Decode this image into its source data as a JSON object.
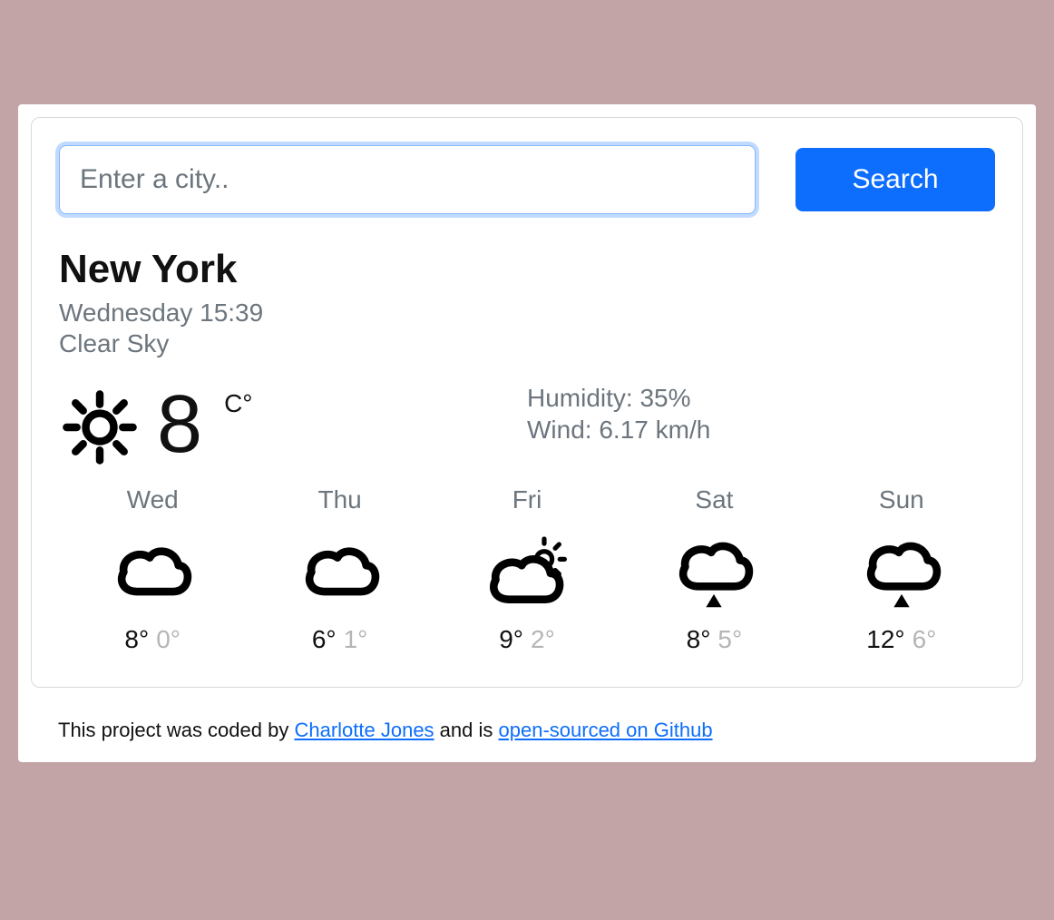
{
  "search": {
    "placeholder": "Enter a city..",
    "button_label": "Search",
    "value": ""
  },
  "current": {
    "city": "New York",
    "day_time": "Wednesday 15:39",
    "condition": "Clear Sky",
    "temp": "8",
    "unit": "C°",
    "icon": "sun",
    "humidity_label": "Humidity: 35%",
    "wind_label": "Wind: 6.17 km/h"
  },
  "forecast": [
    {
      "day": "Wed",
      "icon": "cloud",
      "hi": "8°",
      "lo": "0°"
    },
    {
      "day": "Thu",
      "icon": "cloud",
      "hi": "6°",
      "lo": "1°"
    },
    {
      "day": "Fri",
      "icon": "sun-cloud",
      "hi": "9°",
      "lo": "2°"
    },
    {
      "day": "Sat",
      "icon": "cloud-rain",
      "hi": "8°",
      "lo": "5°"
    },
    {
      "day": "Sun",
      "icon": "cloud-rain",
      "hi": "12°",
      "lo": "6°"
    }
  ],
  "footer": {
    "prefix": "This project was coded by ",
    "author": "Charlotte Jones",
    "middle": " and is ",
    "repo": "open-sourced on Github"
  }
}
